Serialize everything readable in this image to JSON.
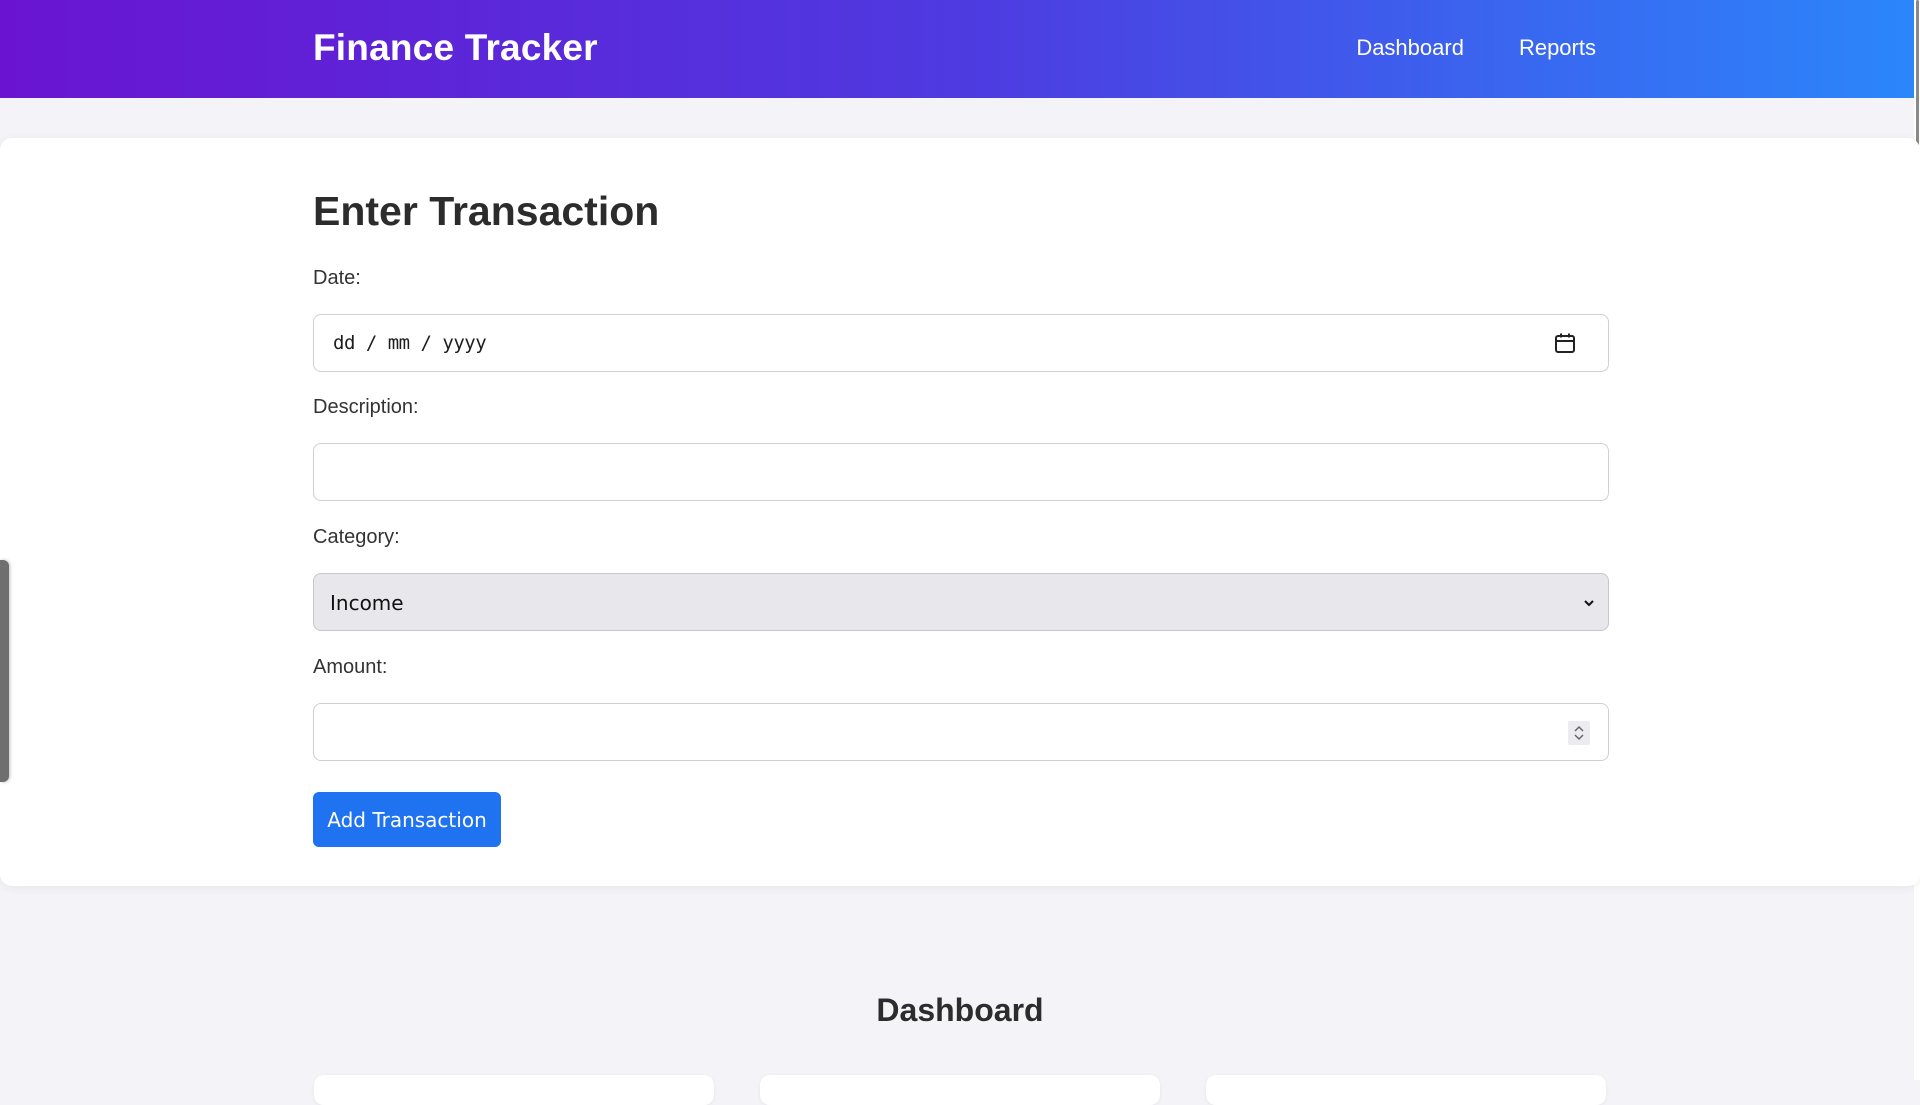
{
  "header": {
    "brand": "Finance Tracker",
    "nav": [
      "Dashboard",
      "Reports"
    ],
    "gradient_colors": [
      "#6a14d1",
      "#2b86fb"
    ]
  },
  "form": {
    "title": "Enter Transaction",
    "date": {
      "label": "Date:",
      "placeholder": "dd / mm / yyyy",
      "icon": "calendar-icon"
    },
    "description": {
      "label": "Description:",
      "value": ""
    },
    "category": {
      "label": "Category:",
      "selected": "Income",
      "icon": "chevron-down-icon"
    },
    "amount": {
      "label": "Amount:",
      "value": "",
      "icon": "spinner-icon"
    },
    "submit_label": "Add Transaction"
  },
  "dashboard": {
    "heading": "Dashboard"
  },
  "colors": {
    "primary_button": "#1f72f0",
    "page_background": "#f4f4f8"
  }
}
